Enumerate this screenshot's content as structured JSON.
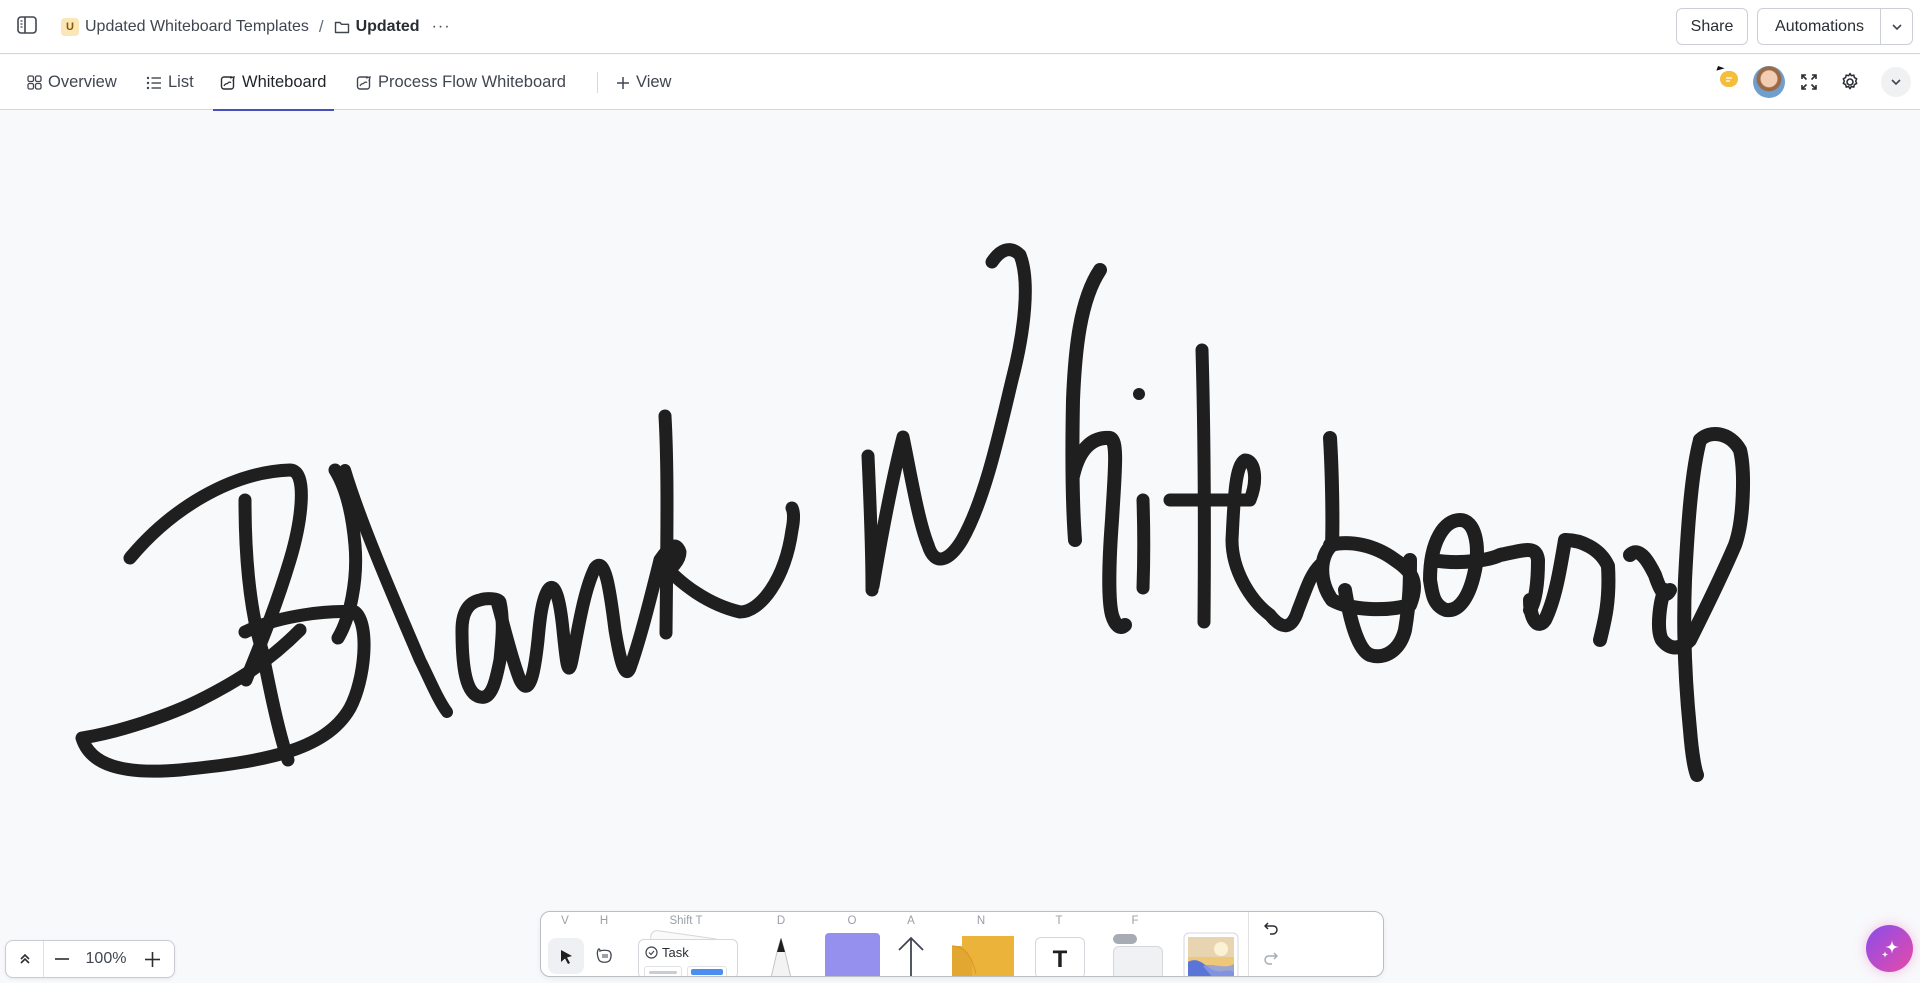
{
  "header": {
    "space_badge": "U",
    "space_name": "Updated Whiteboard Templates",
    "separator": "/",
    "folder_name": "Updated",
    "more_label": "···",
    "share_label": "Share",
    "automations_label": "Automations"
  },
  "views": {
    "tabs": [
      {
        "label": "Overview",
        "icon": "overview-grid-icon",
        "active": false
      },
      {
        "label": "List",
        "icon": "list-icon",
        "active": false
      },
      {
        "label": "Whiteboard",
        "icon": "whiteboard-icon",
        "active": true
      },
      {
        "label": "Process Flow Whiteboard",
        "icon": "whiteboard-icon",
        "active": false
      }
    ],
    "add_view_label": "View",
    "accent_color": "#4a4fbd"
  },
  "canvas": {
    "handwritten_text": "Blank Whiteboard",
    "stroke_color": "#1f1f1f"
  },
  "zoom": {
    "level": "100%"
  },
  "toolbar": {
    "tools": [
      {
        "key": "V",
        "name": "select"
      },
      {
        "key": "H",
        "name": "hand"
      },
      {
        "key": "Shift T",
        "name": "task",
        "label": "Task"
      },
      {
        "key": "D",
        "name": "pen"
      },
      {
        "key": "O",
        "name": "shape"
      },
      {
        "key": "A",
        "name": "connector"
      },
      {
        "key": "N",
        "name": "sticky-note"
      },
      {
        "key": "T",
        "name": "text",
        "glyph": "T"
      },
      {
        "key": "F",
        "name": "frame"
      },
      {
        "key": "",
        "name": "image"
      }
    ],
    "shape_color": "#9590ee",
    "sticky_color": "#ecb33a"
  }
}
